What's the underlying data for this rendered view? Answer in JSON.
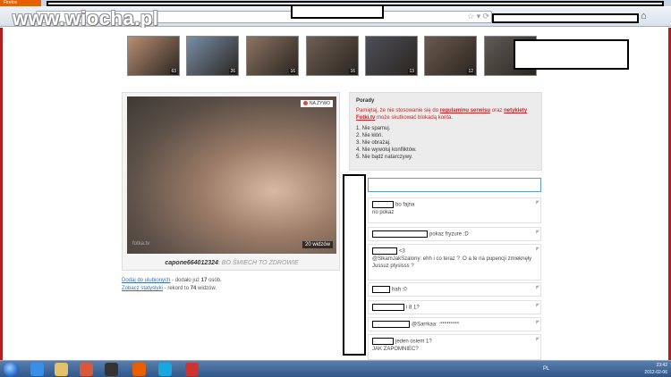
{
  "browser": {
    "app_label": "Firefox",
    "watermark": "www.wiocha.pl"
  },
  "thumbnails": [
    {
      "count": "63",
      "color": "#b98e73"
    },
    {
      "count": "26",
      "color": "#7a8fa8"
    },
    {
      "count": "16",
      "color": "#8a7462"
    },
    {
      "count": "16",
      "color": "#6e5f52"
    },
    {
      "count": "13",
      "color": "#4d4f58"
    },
    {
      "count": "12",
      "color": "#6b5a4e"
    },
    {
      "count": "",
      "color": "#5e5c56"
    }
  ],
  "stream": {
    "live_label": "NA ŻYWO",
    "viewers": "20 widzów",
    "watermark": "fotka.tv",
    "username": "capone664012324",
    "quote": "BO ŚMIECH TO ZDROWIE",
    "favorite_link": "Dodaj do ulubionych",
    "favorite_rest": " - dodało już ",
    "favorite_count": "17",
    "favorite_suffix": " osób.",
    "stats_link": "Zobacz statystyki",
    "stats_rest": " - rekord to ",
    "stats_count": "74",
    "stats_suffix": " widzów."
  },
  "rules": {
    "title": "Porady",
    "warn_prefix": "Pamiętaj, że nie stosowanie się do ",
    "warn_link1": "regulaminu serwisu",
    "warn_mid": " oraz ",
    "warn_link2": "netykiety Fotki.tv",
    "warn_suffix": " może skutkować blokadą konta.",
    "items": [
      "1.  Nie spamuj.",
      "2.  Nie kłóń.",
      "3.  Nie obrażaj.",
      "4.  Nie wywołuj konfliktów.",
      "5.  Nie bądź natarczywy."
    ]
  },
  "chat": {
    "input_value": "",
    "messages": [
      {
        "text": "bo fajna",
        "text2": "no pokaz"
      },
      {
        "text": "pokaz fryzure :D",
        "text2": ""
      },
      {
        "text": "<3",
        "text2": "@SlkamJakSzalony: ehh i co teraz ? :O a te na pupencji zmieknęły Jussuz ptysisss ?"
      },
      {
        "text": "hah :0",
        "text2": ""
      },
      {
        "text": "i 8 1?",
        "text2": ""
      },
      {
        "text": "@Sarrkaa: :*********",
        "text2": ""
      },
      {
        "text": "jeden osiem 1?",
        "text2": "JAK ZAPOMNIEC?"
      }
    ]
  },
  "taskbar": {
    "lang": "PL",
    "time": "23:42",
    "date": "2012-02-06"
  }
}
